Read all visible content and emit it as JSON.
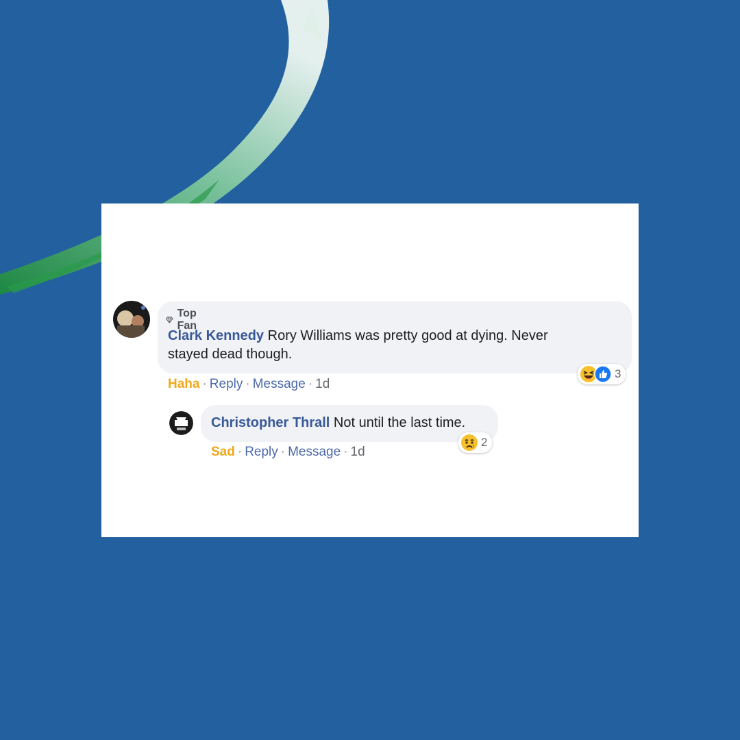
{
  "colors": {
    "background": "#2260a0",
    "brush_gradient": [
      "#e8f4ee",
      "#1e8a3e"
    ],
    "author_link": "#385898",
    "reaction_word": "#f0a81a",
    "bubble": "#f0f2f5"
  },
  "comment": {
    "badge_icon": "diamond-icon",
    "badge": "Top Fan",
    "author": "Clark Kennedy",
    "text_line1": "Rory Williams was pretty good at dying. Never",
    "text_line2": "stayed dead though.",
    "reaction_word": "Haha",
    "reply_label": "Reply",
    "message_label": "Message",
    "time": "1d",
    "reactions": [
      "haha-emoji-icon",
      "like-icon"
    ],
    "reaction_count": "3"
  },
  "reply": {
    "author": "Christopher Thrall",
    "text": "Not until the last time.",
    "reaction_word": "Sad",
    "reply_label": "Reply",
    "message_label": "Message",
    "time": "1d",
    "reactions": [
      "sad-emoji-icon"
    ],
    "reaction_count": "2"
  }
}
